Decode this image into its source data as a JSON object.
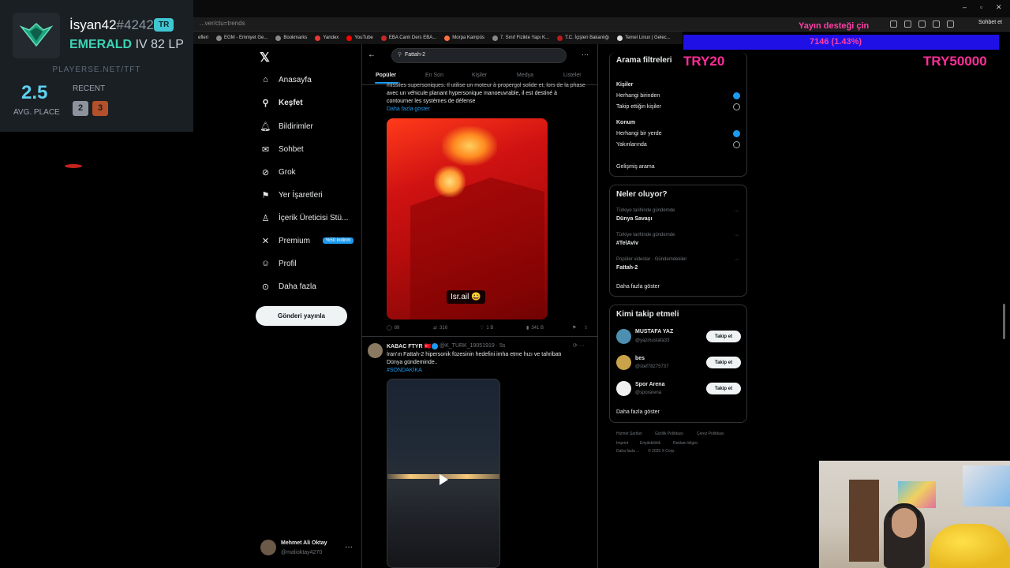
{
  "browser": {
    "url": "...ver/ctu=trends",
    "chat_label": "Sohbet et",
    "bookmarks": [
      "efleri",
      "EGM - Emniyet Ge...",
      "Bookmarks",
      "Yandex",
      "YouTube",
      "EBA Canlı Ders EBA...",
      "Morpa Kampüs",
      "7. Sınıf Fizikte Yapı K...",
      "T.C. İçişleri Bakanlığı",
      "Temel Linux | Gelec..."
    ]
  },
  "tft": {
    "name": "İsyan42",
    "tag": "#4242",
    "region": "TR",
    "rank": "EMERALD",
    "division": "IV 82 LP",
    "site": "PLAYERSE.NET/TFT",
    "avg_place": "2.5",
    "avg_label": "AVG. PLACE",
    "recent_label": "RECENT",
    "recent_places": [
      "2",
      "3"
    ]
  },
  "nav": {
    "items": [
      {
        "label": "Anasayfa",
        "icon": "home-icon"
      },
      {
        "label": "Keşfet",
        "icon": "search-icon"
      },
      {
        "label": "Bildirimler",
        "icon": "bell-icon"
      },
      {
        "label": "Sohbet",
        "icon": "mail-icon"
      },
      {
        "label": "Grok",
        "icon": "grok-icon"
      },
      {
        "label": "Yer İşaretleri",
        "icon": "bookmark-icon"
      },
      {
        "label": "İçerik Üreticisi Stü...",
        "icon": "creator-icon"
      },
      {
        "label": "Premium",
        "icon": "x-icon"
      },
      {
        "label": "Profil",
        "icon": "person-icon"
      },
      {
        "label": "Daha fazla",
        "icon": "more-circle-icon"
      }
    ],
    "premium_badge": "%50 indirim",
    "post_button": "Gönderi yayınla",
    "profile_name": "Mehmet Ali Oktay",
    "profile_handle": "@malioktay4270"
  },
  "search": {
    "query": "Fattah-2",
    "tabs": [
      "Popüler",
      "En Son",
      "Kişiler",
      "Medya",
      "Listeler"
    ]
  },
  "tweet1": {
    "text_line1": "missiles supersoniques. Il utilise un moteur à propergol solide et, lors de la phase",
    "text_line2": "avec un véhicule planant hypersonique manoeuvrable, il est destiné à",
    "text_line3": "contourner les systèmes de défense",
    "show_more": "Daha fazla göster",
    "media_caption": "Isr.ail 😀",
    "replies": "89",
    "reposts": "316",
    "likes": "1 B",
    "views": "341 B"
  },
  "tweet2": {
    "author": "KABAC FTYR 🇹🇷",
    "handle": "@K_TURK_19051919 · 5s",
    "text_line1": "İran'ın Fattah-2 hipersonik füzesinin hedefini imha etme hızı ve tahribatı",
    "text_line2": "Dünya gündeminde..",
    "hashtag": "#SONDAKİKA"
  },
  "filters": {
    "title": "Arama filtreleri",
    "people_label": "Kişiler",
    "people_options": [
      "Herhangi birinden",
      "Takip ettiğin kişiler"
    ],
    "location_label": "Konum",
    "location_options": [
      "Herhangi bir yerde",
      "Yakınlarında"
    ],
    "advanced": "Gelişmiş arama"
  },
  "trends": {
    "title": "Neler oluyor?",
    "items": [
      {
        "context": "Türkiye tarihinde gündemde",
        "name": "Dünya Savaşı"
      },
      {
        "context": "Türkiye tarihinde gündemde",
        "name": "#TelAviv"
      },
      {
        "context": "Popüler videolar · Gündemdekiler",
        "name": "Fattah-2"
      }
    ],
    "show_more": "Daha fazla göster"
  },
  "who_to_follow": {
    "title": "Kimi takip etmeli",
    "users": [
      {
        "name": "MUSTAFA YAZ",
        "handle": "@yazmustafa33",
        "button": "Takip et"
      },
      {
        "name": "bes",
        "handle": "@stef78275737",
        "button": "Takip et"
      },
      {
        "name": "Spor Arena",
        "handle": "@sporarena",
        "button": "Takip et"
      }
    ],
    "show_more": "Daha fazla göster"
  },
  "footer": {
    "links": [
      "Hizmet Şartları",
      "Gizlilik Politikası",
      "Çerez Politikası",
      "Imprint",
      "Erişilebilirlik",
      "Reklam bilgisi",
      "Daha fazla ...",
      "© 2025 X Corp."
    ]
  },
  "donation": {
    "title": "Yayın desteği çin",
    "value": "7146 (1.43%)",
    "progress": 0.0143,
    "goal_start": "TRY20",
    "goal_end": "TRY50000"
  },
  "colors": {
    "accent": "#1d9bf0",
    "overlay_pink": "#ff2d9a",
    "overlay_bar": "#1f10e6",
    "emerald": "#3dd4b5"
  }
}
